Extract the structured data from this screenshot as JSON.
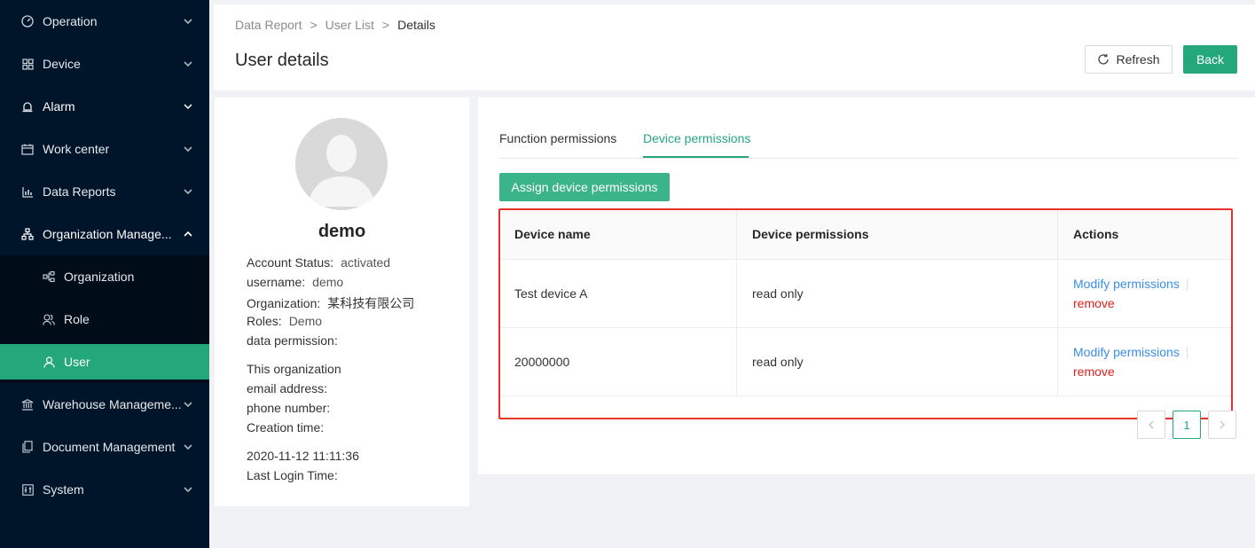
{
  "sidebar": {
    "items": [
      {
        "label": "Operation",
        "icon": "dashboard-icon"
      },
      {
        "label": "Device",
        "icon": "grid-icon"
      },
      {
        "label": "Alarm",
        "icon": "alarm-icon"
      },
      {
        "label": "Work center",
        "icon": "calendar-icon"
      },
      {
        "label": "Data Reports",
        "icon": "bar-chart-icon"
      },
      {
        "label": "Organization Manage...",
        "icon": "org-chart-icon"
      },
      {
        "label": "Warehouse Manageme...",
        "icon": "bank-icon"
      },
      {
        "label": "Document Management",
        "icon": "document-icon"
      },
      {
        "label": "System",
        "icon": "sliders-icon"
      }
    ],
    "sub_items": [
      {
        "label": "Organization",
        "icon": "cluster-icon"
      },
      {
        "label": "Role",
        "icon": "users-icon"
      },
      {
        "label": "User",
        "icon": "user-icon"
      }
    ]
  },
  "header": {
    "breadcrumb": [
      "Data Report",
      "User List",
      "Details"
    ],
    "separator": ">",
    "title": "User details",
    "refresh_label": "Refresh",
    "back_label": "Back"
  },
  "profile": {
    "name": "demo",
    "fields": [
      {
        "label": "Account Status:",
        "value": "activated"
      },
      {
        "label": "username:",
        "value": "demo"
      },
      {
        "label": "Organization:",
        "value": "某科技有限公司"
      },
      {
        "label": "Roles:",
        "value": "Demo"
      },
      {
        "label": "data permission:",
        "value": ""
      },
      {
        "label": "This organization",
        "value": ""
      },
      {
        "label": "email address:",
        "value": ""
      },
      {
        "label": "phone number:",
        "value": ""
      },
      {
        "label": "Creation time:",
        "value": ""
      },
      {
        "label": "2020-11-12 11:11:36",
        "value": ""
      },
      {
        "label": "Last Login Time:",
        "value": ""
      }
    ]
  },
  "tabs": [
    {
      "label": "Function permissions"
    },
    {
      "label": "Device permissions"
    }
  ],
  "assign_button": "Assign device permissions",
  "table": {
    "columns": [
      "Device name",
      "Device permissions",
      "Actions"
    ],
    "rows": [
      {
        "name": "Test device A",
        "permission": "read only"
      },
      {
        "name": "20000000",
        "permission": "read only"
      }
    ],
    "modify_label": "Modify permissions",
    "remove_label": "remove"
  },
  "pagination": {
    "current": "1",
    "prev": "‹",
    "next": "›"
  },
  "colors": {
    "accent": "#24a77a",
    "sidebar": "#001529",
    "highlight": "#e8322a",
    "link": "#3a8ee6",
    "danger": "#e02020"
  }
}
